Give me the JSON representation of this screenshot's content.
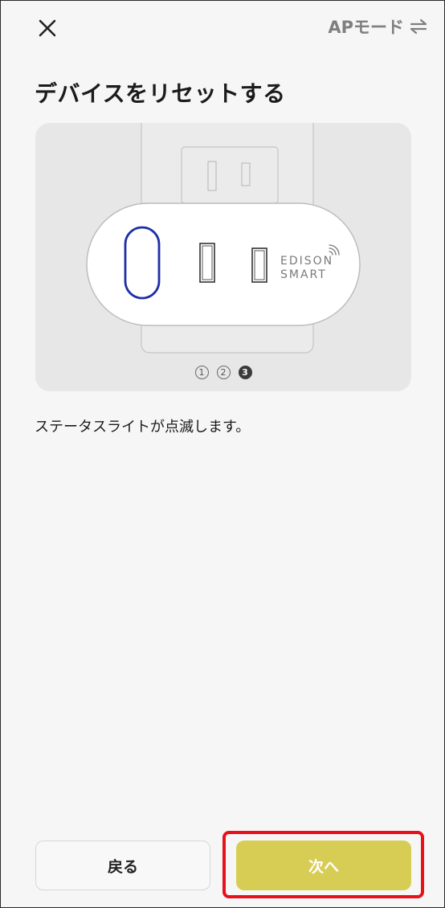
{
  "header": {
    "ap_mode_label": "APモード"
  },
  "page": {
    "title": "デバイスをリセットする",
    "description": "ステータスライトが点滅します。"
  },
  "illustration": {
    "brand_line1": "EDISON",
    "brand_line2": "SMART",
    "steps": [
      "1",
      "2",
      "3"
    ],
    "current_step": 3,
    "highlight_color": "#1f2fa6"
  },
  "footer": {
    "back_label": "戻る",
    "next_label": "次へ"
  },
  "colors": {
    "next_button": "#d8cd54",
    "highlight_box": "#e8101a"
  },
  "icons": {
    "close": "close-icon",
    "swap": "swap-arrows-icon"
  }
}
